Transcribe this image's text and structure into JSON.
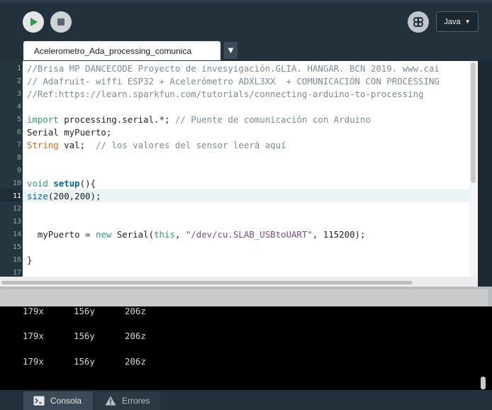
{
  "toolbar": {
    "run_icon": "play-icon",
    "stop_icon": "stop-icon",
    "mode_icon": "debug-butterfly-icon",
    "mode_select": "Java",
    "accent_run": "#2e9c4b"
  },
  "tab": {
    "name": "Acelerometro_Ada_processing_comunica",
    "menu_glyph": "▼"
  },
  "editor": {
    "line_numbers": [
      "1",
      "2",
      "3",
      "4",
      "5",
      "6",
      "7",
      "8",
      "9",
      "10",
      "11",
      "12",
      "13",
      "14",
      "15",
      "16",
      "17"
    ],
    "active_line": "11",
    "lines": [
      "//Brisa MP DANCECODE Proyecto de invesyigación.GLIA. HANGAR. BCN 2019. www.cai",
      "// Adafruit- wiffi ESP32 + Acelerómetro ADXL3XX  + COMUNICACIÓN CON PROCESSING",
      "//Ref:https://learn.sparkfun.com/tutorials/connecting-arduino-to-processing",
      "",
      "import processing.serial.*; // Puente de comunicación con Arduino",
      "Serial myPuerto;",
      "String val;  // los valores del sensor leerá aquí",
      "",
      "",
      "void setup(){",
      "size(200,200);",
      "",
      "",
      "  myPuerto = new Serial(this, \"/dev/cu.SLAB_USBtoUART\", 115200);",
      "",
      "}",
      ""
    ],
    "tokens": {
      "l5_kw": "import",
      "l5_rest": " processing.serial.*; ",
      "l5_cm": "// Puente de comunicación con Arduino",
      "l7_ty": "String",
      "l7_rest": " val;  ",
      "l7_cm": "// los valores del sensor leerá aquí",
      "l10_kw": "void",
      "l10_fn": "setup",
      "l10_rest": "(){",
      "l11_fn": "size",
      "l11_rest": "(200,200);",
      "l14_a": "  myPuerto = ",
      "l14_new": "new",
      "l14_b": " Serial(",
      "l14_this": "this",
      "l14_c": ", ",
      "l14_str": "\"/dev/cu.SLAB_USBtoUART\"",
      "l14_d": ", 115200);"
    }
  },
  "console": {
    "rows": [
      {
        "x": "179x",
        "y": "156y",
        "z": "206z"
      },
      {
        "x": "179x",
        "y": "156y",
        "z": "206z"
      },
      {
        "x": "179x",
        "y": "156y",
        "z": "206z"
      }
    ]
  },
  "status_tabs": {
    "console_label": "Consola",
    "console_icon": "terminal-icon",
    "errors_label": "Errores",
    "errors_icon": "warning-icon"
  }
}
